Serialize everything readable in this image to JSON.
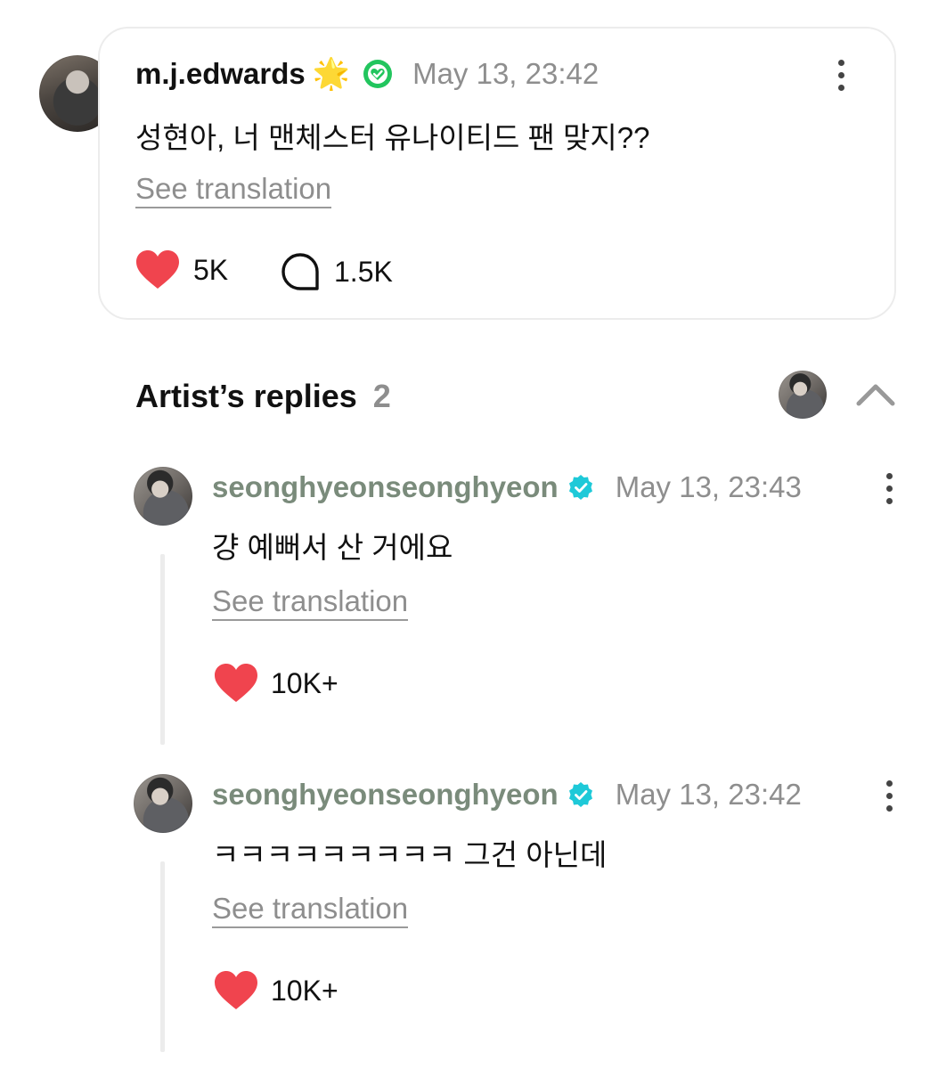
{
  "post": {
    "username": "m.j.edwards",
    "username_emoji": "🌟",
    "timestamp": "May 13, 23:42",
    "text": "성현아, 너 맨체스터 유나이티드 팬 맞지??",
    "see_translation": "See translation",
    "likes": "5K",
    "comments": "1.5K"
  },
  "artist_replies": {
    "title": "Artist’s replies",
    "count": "2"
  },
  "replies": [
    {
      "username": "seonghyeonseonghyeon",
      "timestamp": "May 13, 23:43",
      "text": "걍 예뻐서 산 거에요",
      "see_translation": "See translation",
      "likes": "10K+"
    },
    {
      "username": "seonghyeonseonghyeon",
      "timestamp": "May 13, 23:42",
      "text": "ㅋㅋㅋㅋㅋㅋㅋㅋㅋ 그건 아닌데",
      "see_translation": "See translation",
      "likes": "10K+"
    }
  ],
  "colors": {
    "heart": "#f0444e",
    "verified_green": "#22c55e",
    "verified_teal": "#1ec9d8",
    "artist_name": "#7a8b7b",
    "muted_text": "#8e8e8e"
  },
  "icons": {
    "like": "heart-icon",
    "comment": "comment-bubble-icon",
    "more": "kebab-menu-icon",
    "collapse": "chevron-up-icon",
    "post_badge": "verified-heart-badge-icon",
    "artist_badge": "verified-check-badge-icon"
  }
}
